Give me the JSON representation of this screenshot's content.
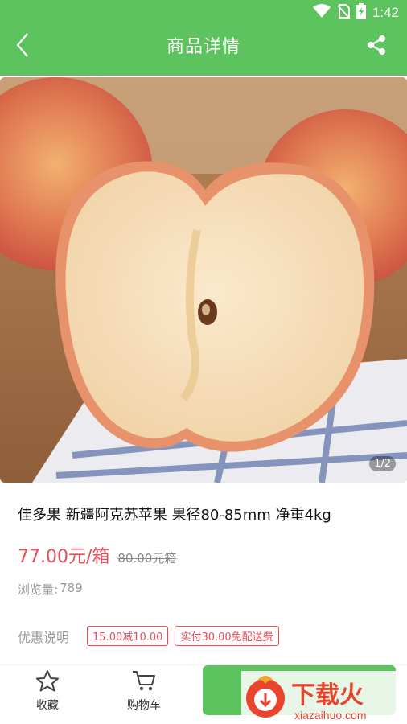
{
  "status": {
    "time": "1:42",
    "icons": [
      "wifi-icon",
      "no-sim-icon",
      "battery-icon"
    ]
  },
  "header": {
    "title": "商品详情",
    "back_icon": "back-arrow-icon",
    "share_icon": "share-icon"
  },
  "gallery": {
    "counter": "1/2"
  },
  "product": {
    "title": "佳多果 新疆阿克苏苹果 果径80-85mm 净重4kg",
    "price": "77.00元/箱",
    "original_price": "80.00元箱",
    "views_label": "浏览量:",
    "views_count": "789"
  },
  "promotions": {
    "label": "优惠说明",
    "tags": [
      "15.00减10.00",
      "实付30.00免配送费"
    ]
  },
  "bottom_bar": {
    "favorite_label": "收藏",
    "cart_label": "购物车"
  },
  "watermark": {
    "text": "下载火",
    "url_text": "xiazaihuo.com"
  },
  "colors": {
    "accent": "#5cc35f",
    "price": "#e94d5a"
  }
}
